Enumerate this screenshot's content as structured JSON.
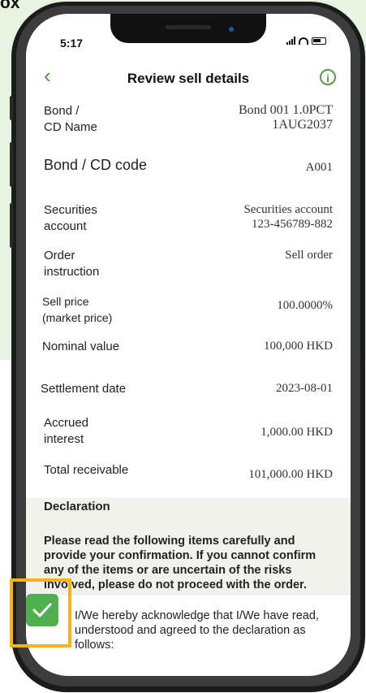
{
  "corner_label": "ox",
  "status": {
    "time": "5:17"
  },
  "nav": {
    "title": "Review sell details"
  },
  "details": [
    {
      "label": "Bond /\nCD Name",
      "value": "Bond 001 1.0PCT\n1AUG2037"
    },
    {
      "label": "Bond / CD code",
      "value": "A001"
    },
    {
      "label": "Securities\naccount",
      "value": "Securities account\n123-456789-882"
    },
    {
      "label": "Order\ninstruction",
      "value": "Sell order"
    },
    {
      "label": "Sell price\n(market price)",
      "value": "100.0000%"
    },
    {
      "label": "Nominal value",
      "value": "100,000 HKD"
    },
    {
      "label": "Settlement date",
      "value": "2023-08-01"
    },
    {
      "label": "Accrued\ninterest",
      "value": "1,000.00 HKD"
    },
    {
      "label": "Total receivable",
      "value": "101,000.00 HKD"
    }
  ],
  "declaration": {
    "title": "Declaration",
    "text": "Please read the following items carefully and provide your confirmation. If you cannot confirm any of the items or are uncertain of the risks involved, please do not proceed with the order.",
    "acknowledge": "I/We hereby acknowledge that I/We have read, understood and agreed to the declaration as follows:",
    "checked": true
  },
  "colors": {
    "accent": "#4fb050",
    "highlight": "#f2b418",
    "backdrop": "#e9f3e2"
  }
}
